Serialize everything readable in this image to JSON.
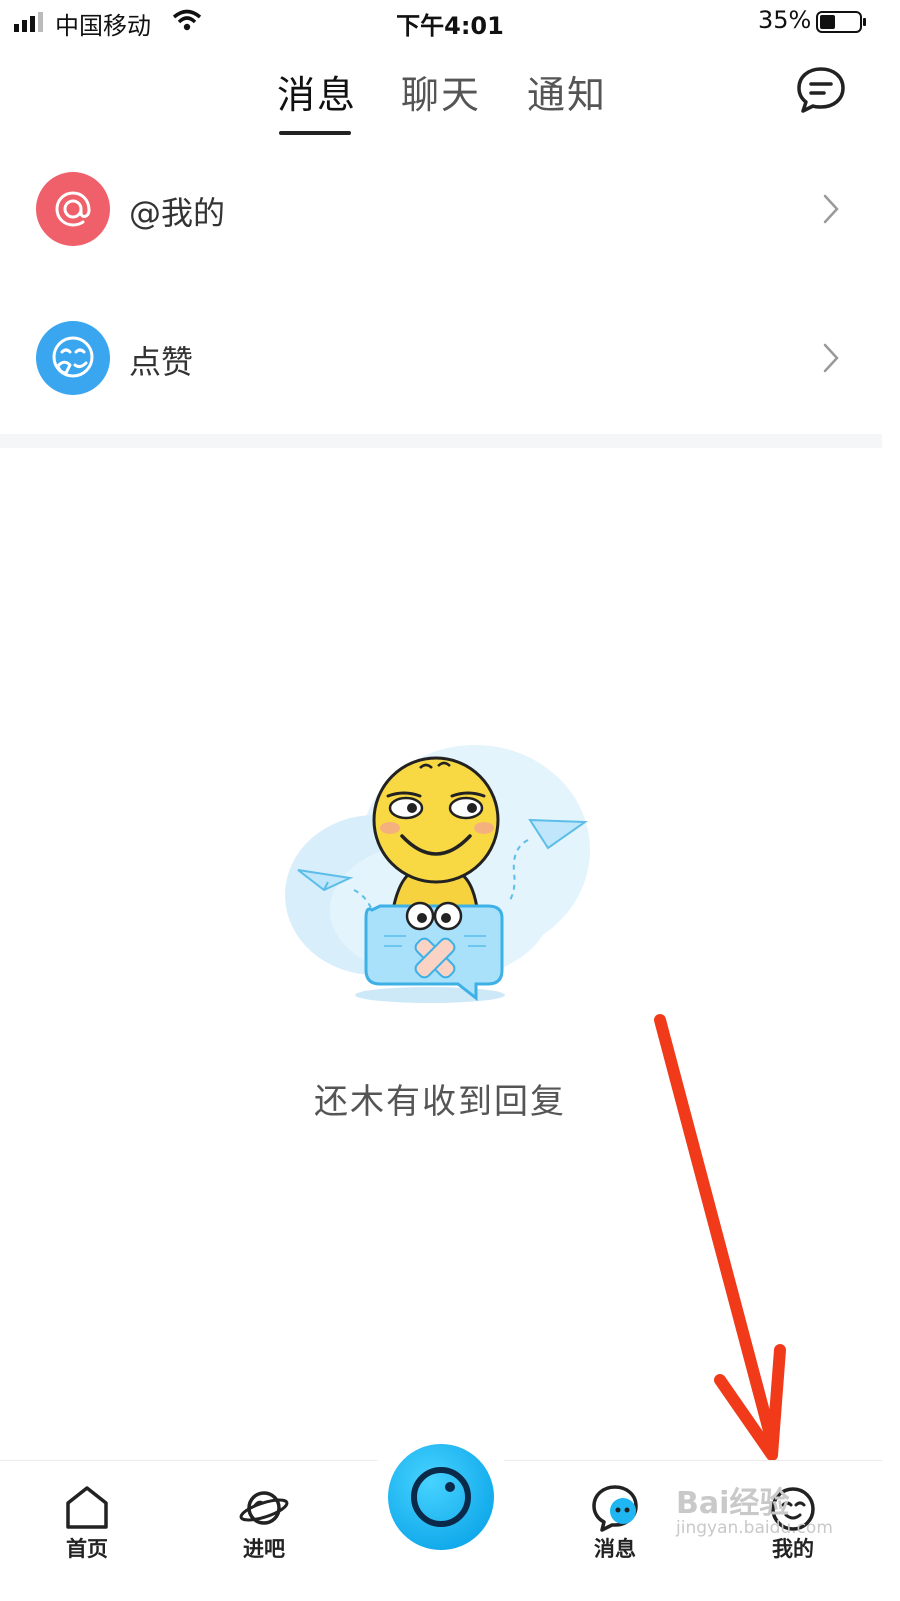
{
  "status_bar": {
    "carrier": "中国移动",
    "time": "下午4:01",
    "battery": "35%"
  },
  "tabs": [
    {
      "label": "消息",
      "active": true
    },
    {
      "label": "聊天",
      "active": false
    },
    {
      "label": "通知",
      "active": false
    }
  ],
  "header": {
    "right_icon": "chat-bubble-icon"
  },
  "list": [
    {
      "label": "@我的",
      "icon": "at-icon",
      "color": "#f0606a"
    },
    {
      "label": "点赞",
      "icon": "like-face-icon",
      "color": "#3aa6f0"
    }
  ],
  "empty_state": {
    "text": "还木有收到回复"
  },
  "bottom_nav": [
    {
      "label": "首页",
      "icon": "home-icon"
    },
    {
      "label": "进吧",
      "icon": "planet-icon"
    },
    {
      "label": "",
      "icon": "camera-icon"
    },
    {
      "label": "消息",
      "icon": "message-icon",
      "active": true
    },
    {
      "label": "我的",
      "icon": "profile-face-icon"
    }
  ],
  "watermark": {
    "main": "Bai经验",
    "sub": "jingyan.baidu.com"
  },
  "colors": {
    "accent_blue": "#1fb6f2",
    "annotation_red": "#f03a1a",
    "at_red": "#f0606a",
    "like_blue": "#3aa6f0"
  }
}
